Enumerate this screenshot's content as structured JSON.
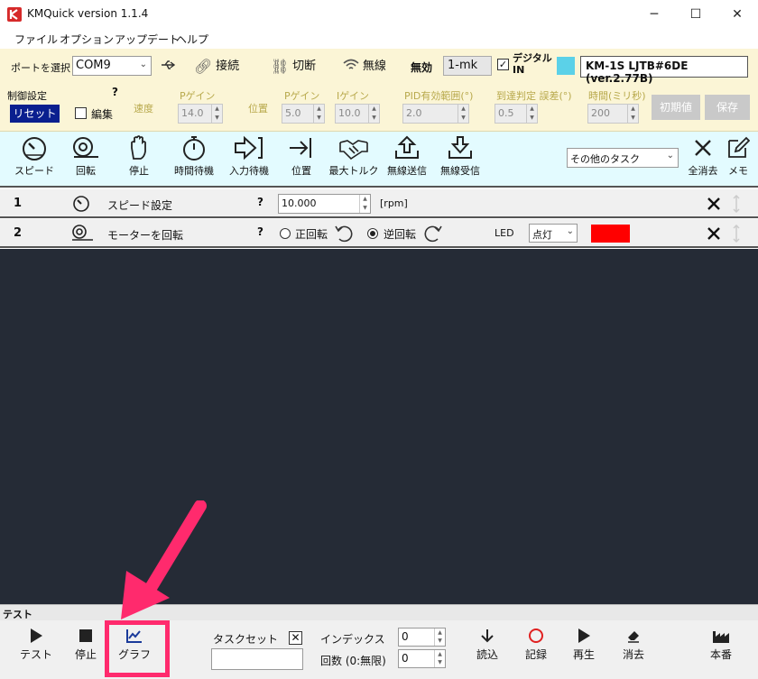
{
  "window": {
    "title": "KMQuick version 1.1.4",
    "minimize": "─",
    "maximize": "☐",
    "close": "✕"
  },
  "menu": [
    "ファイル",
    "オプション",
    "アップデート",
    "ヘルプ"
  ],
  "connection": {
    "port_label": "ポートを選択",
    "port_value": "COM9",
    "connect": "接続",
    "disconnect": "切断",
    "wireless": "無線",
    "disabled": "無効",
    "mode_value": "1-mk",
    "digital_in": "デジタル\nIN",
    "digital_in_checked": true,
    "device": "KM-1S LJTB#6DE (ver.2.77B)",
    "device_color": "#5bd1e8"
  },
  "control": {
    "title": "制御設定",
    "help": "?",
    "reset": "リセット",
    "edit": "編集",
    "speed": "速度",
    "p_gain_label": "Pゲイン",
    "p_gain_value": "14.0",
    "position": "位置",
    "p_gain2_label": "Pゲイン",
    "p_gain2_value": "5.0",
    "i_gain_label": "Iゲイン",
    "i_gain_value": "10.0",
    "pid_label": "PID有効範囲(°)",
    "pid_value": "2.0",
    "reach_label": "到達判定 誤差(°)",
    "reach_value": "0.5",
    "time_label": "時間(ミリ秒)",
    "time_value": "200",
    "default_btn": "初期値",
    "save_btn": "保存"
  },
  "toolbar": {
    "items": [
      "スピード",
      "回転",
      "停止",
      "時間待機",
      "入力待機",
      "位置",
      "最大トルク",
      "無線送信",
      "無線受信"
    ],
    "other_tasks": "その他のタスク",
    "clear_all": "全消去",
    "memo": "メモ"
  },
  "tasks": [
    {
      "num": "1",
      "name": "スピード設定",
      "help": "?",
      "value": "10.000",
      "unit": "[rpm]"
    },
    {
      "num": "2",
      "name": "モーターを回転",
      "help": "?",
      "forward": "正回転",
      "reverse": "逆回転",
      "reverse_selected": true,
      "led_label": "LED",
      "led_value": "点灯",
      "led_color": "#ff0000"
    }
  ],
  "test_panel": {
    "header": "テスト",
    "test": "テスト",
    "stop": "停止",
    "graph": "グラフ",
    "taskset": "タスクセット",
    "index_label": "インデックス",
    "index_value": "0",
    "count_label": "回数 (0:無限)",
    "count_value": "0",
    "read": "読込",
    "record": "記録",
    "play": "再生",
    "erase": "消去",
    "production": "本番"
  },
  "annotation_color": "#ff2a6d"
}
